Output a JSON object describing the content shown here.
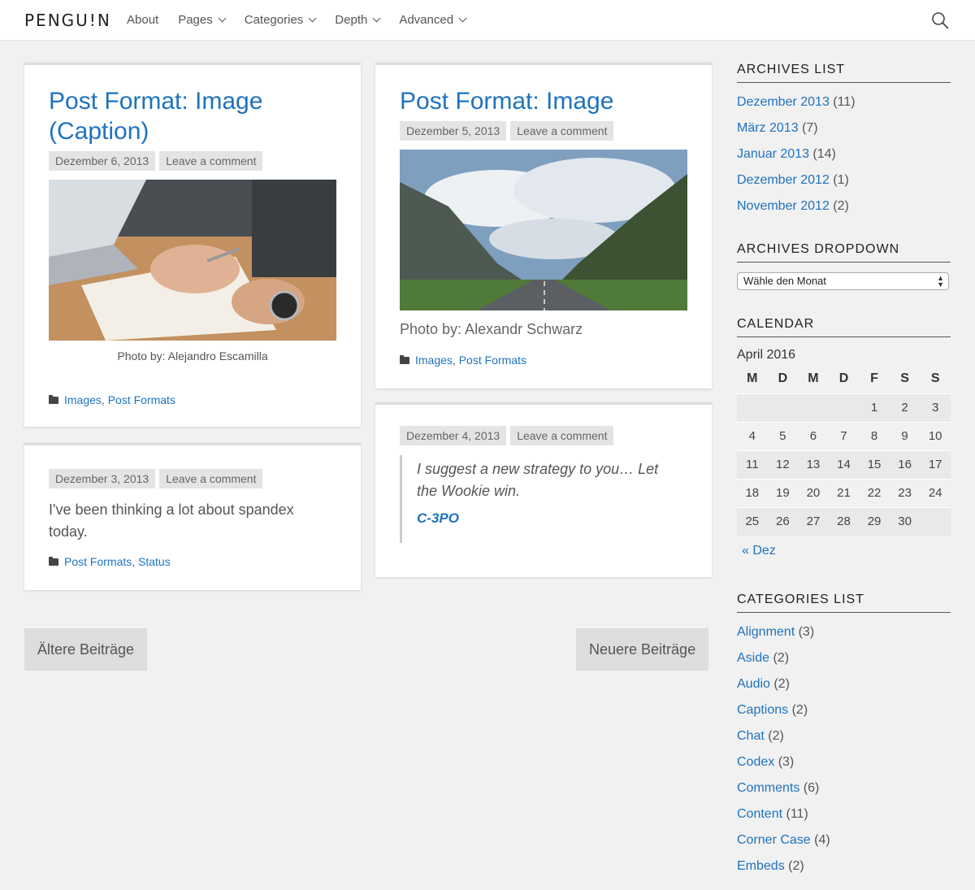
{
  "header": {
    "logo": "PENGU!N",
    "nav": [
      {
        "label": "About"
      },
      {
        "label": "Pages"
      },
      {
        "label": "Categories"
      },
      {
        "label": "Depth"
      },
      {
        "label": "Advanced"
      }
    ]
  },
  "posts": {
    "p1": {
      "title_line1": "Post Format: Image",
      "title_line2": "(Caption)",
      "date": "Dezember 6, 2013",
      "comment": "Leave a comment",
      "caption": "Photo by: Alejandro Escamilla",
      "cat1": "Images",
      "cat2": "Post Formats"
    },
    "p2": {
      "title": "Post Format: Image",
      "date": "Dezember 5, 2013",
      "comment": "Leave a comment",
      "caption": "Photo by: Alexandr Schwarz",
      "cat1": "Images",
      "cat2": "Post Formats"
    },
    "p3": {
      "date": "Dezember 3, 2013",
      "comment": "Leave a comment",
      "text": "I've been thinking a lot about spandex today.",
      "cat1": "Post Formats",
      "cat2": "Status"
    },
    "p4": {
      "date": "Dezember 4, 2013",
      "comment": "Leave a comment",
      "quote": "I suggest a new strategy to you… Let the Wookie win.",
      "cite": "C-3PO"
    }
  },
  "pagination": {
    "older": "Ältere Beiträge",
    "newer": "Neuere Beiträge"
  },
  "sidebar": {
    "archives_title": "ARCHIVES LIST",
    "archives": [
      {
        "label": "Dezember 2013",
        "count": " (11)"
      },
      {
        "label": "März 2013",
        "count": " (7)"
      },
      {
        "label": "Januar 2013",
        "count": " (14)"
      },
      {
        "label": "Dezember 2012",
        "count": " (1)"
      },
      {
        "label": "November 2012",
        "count": " (2)"
      }
    ],
    "dropdown_title": "ARCHIVES DROPDOWN",
    "dropdown_value": "Wähle den Monat",
    "calendar_title": "CALENDAR",
    "calendar_caption": "April 2016",
    "calendar_days": [
      "M",
      "D",
      "M",
      "D",
      "F",
      "S",
      "S"
    ],
    "calendar_weeks": [
      [
        "",
        "",
        "",
        "",
        "1",
        "2",
        "3"
      ],
      [
        "4",
        "5",
        "6",
        "7",
        "8",
        "9",
        "10"
      ],
      [
        "11",
        "12",
        "13",
        "14",
        "15",
        "16",
        "17"
      ],
      [
        "18",
        "19",
        "20",
        "21",
        "22",
        "23",
        "24"
      ],
      [
        "25",
        "26",
        "27",
        "28",
        "29",
        "30",
        ""
      ]
    ],
    "calendar_prev": "« Dez",
    "categories_title": "CATEGORIES LIST",
    "categories": [
      {
        "label": "Alignment",
        "count": " (3)"
      },
      {
        "label": "Aside",
        "count": " (2)"
      },
      {
        "label": "Audio",
        "count": " (2)"
      },
      {
        "label": "Captions",
        "count": " (2)"
      },
      {
        "label": "Chat",
        "count": " (2)"
      },
      {
        "label": "Codex",
        "count": " (3)"
      },
      {
        "label": "Comments",
        "count": " (6)"
      },
      {
        "label": "Content",
        "count": " (11)"
      },
      {
        "label": "Corner Case",
        "count": " (4)"
      },
      {
        "label": "Embeds",
        "count": " (2)"
      }
    ]
  },
  "colors": {
    "link": "#1e73be",
    "background": "#f1f1f1",
    "meta_bg": "#e4e4e4"
  },
  "icons": [
    "search-icon",
    "chevron-down-icon",
    "folder-icon"
  ]
}
